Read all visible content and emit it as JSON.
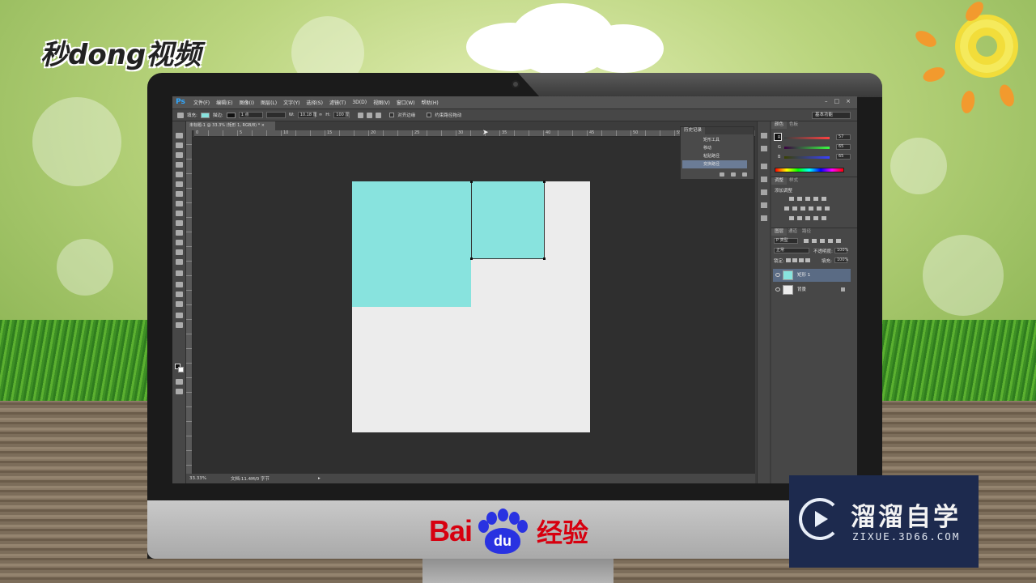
{
  "scene": {
    "brand_text": "秒dong视频",
    "baidu": {
      "left": "Bai",
      "paw_text": "du",
      "right": "经验"
    },
    "watermark": {
      "title": "溜溜自学",
      "url": "ZIXUE.3D66.COM",
      "icon": "play-circle-icon"
    }
  },
  "photoshop": {
    "logo": "Ps",
    "menu": [
      "文件(F)",
      "编辑(E)",
      "图像(I)",
      "图层(L)",
      "文字(Y)",
      "选择(S)",
      "滤镜(T)",
      "3D(D)",
      "视图(V)",
      "窗口(W)",
      "帮助(H)"
    ],
    "window_controls": [
      "–",
      "□",
      "×"
    ],
    "options": {
      "fill_label": "填充:",
      "stroke_label": "描边:",
      "stroke_size": "1 点",
      "w_label": "W:",
      "w_value": "10.18 厘",
      "h_label": "H:",
      "h_value": "100 厘",
      "align_edges": "对齐边缘",
      "constrain_path": "约束路径拖动",
      "workspace": "基本功能",
      "fill_color": "#88e3de",
      "stroke_color": "#111111"
    },
    "document_tab": "未标题-1 @ 33.3% (矩形 1, RGB/8) * ×",
    "ruler_labels": [
      "0",
      "5",
      "10",
      "15",
      "20",
      "25",
      "30",
      "35",
      "40",
      "45",
      "50",
      "55",
      "60"
    ],
    "status": {
      "zoom": "33.33%",
      "doc": "文档:11.4M/0 字节"
    },
    "history": {
      "tab": "历史记录",
      "items": [
        {
          "label": "矩形工具",
          "selected": false
        },
        {
          "label": "移动",
          "selected": false
        },
        {
          "label": "粘贴路径",
          "selected": false
        },
        {
          "label": "变换路径",
          "selected": true
        }
      ]
    },
    "color_panel": {
      "tabs": [
        "颜色",
        "色板"
      ],
      "channels": [
        {
          "label": "R",
          "value": "57"
        },
        {
          "label": "G",
          "value": "65"
        },
        {
          "label": "B",
          "value": "65"
        }
      ]
    },
    "adjustments": {
      "tabs": [
        "调整",
        "样式"
      ],
      "title": "添加调整"
    },
    "layers": {
      "tabs": [
        "图层",
        "通道",
        "路径"
      ],
      "kind": "P 类型",
      "blend_mode": "正常",
      "opacity_label": "不透明度:",
      "opacity_value": "100%",
      "lock_label": "锁定:",
      "fill_label": "填充:",
      "fill_value": "100%",
      "items": [
        {
          "name": "矩形 1",
          "selected": true,
          "thumb_color": "#88e3de"
        },
        {
          "name": "背景",
          "selected": false,
          "thumb_color": "#ececec"
        }
      ]
    }
  }
}
